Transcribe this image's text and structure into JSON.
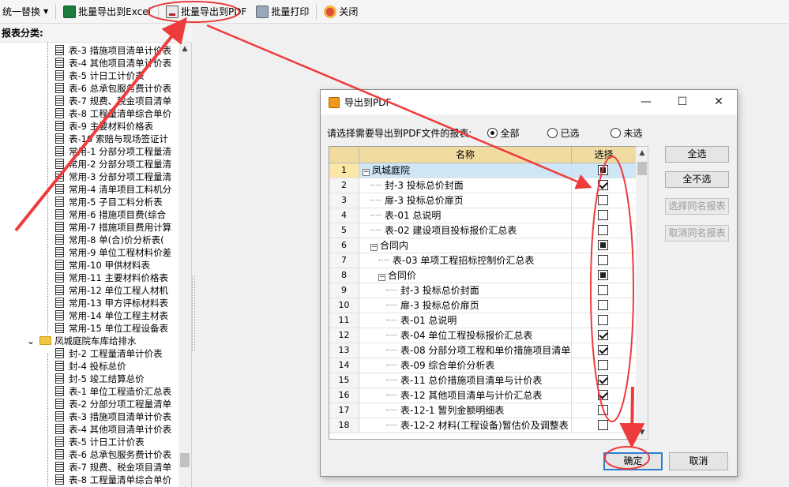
{
  "toolbar": {
    "replace_label": "统一替换",
    "export_excel_label": "批量导出到Excel",
    "export_pdf_label": "批量导出到PDF",
    "batch_print_label": "批量打印",
    "close_label": "关闭"
  },
  "left_panel": {
    "header": "报表分类:",
    "items": [
      {
        "label": "表-3 措施项目清单计价表",
        "type": "doc",
        "indent": 1
      },
      {
        "label": "表-4 其他项目清单计价表",
        "type": "doc",
        "indent": 1
      },
      {
        "label": "表-5 计日工计价表",
        "type": "doc",
        "indent": 1
      },
      {
        "label": "表-6 总承包服务费计价表",
        "type": "doc",
        "indent": 1
      },
      {
        "label": "表-7 规费、税金项目清单",
        "type": "doc",
        "indent": 1
      },
      {
        "label": "表-8 工程量清单综合单价",
        "type": "doc",
        "indent": 1
      },
      {
        "label": "表-9 主要材料价格表",
        "type": "doc",
        "indent": 1
      },
      {
        "label": "表-10 索赔与现场签证计",
        "type": "doc",
        "indent": 1
      },
      {
        "label": "常用-1 分部分项工程量清",
        "type": "doc",
        "indent": 1
      },
      {
        "label": "常用-2 分部分项工程量清",
        "type": "doc",
        "indent": 1
      },
      {
        "label": "常用-3 分部分项工程量清",
        "type": "doc",
        "indent": 1
      },
      {
        "label": "常用-4 清单项目工料机分",
        "type": "doc",
        "indent": 1
      },
      {
        "label": "常用-5 子目工料分析表",
        "type": "doc",
        "indent": 1
      },
      {
        "label": "常用-6 措施项目费(综合",
        "type": "doc",
        "indent": 1
      },
      {
        "label": "常用-7 措施项目费用计算",
        "type": "doc",
        "indent": 1
      },
      {
        "label": "常用-8 单(合)价分析表(",
        "type": "doc",
        "indent": 1
      },
      {
        "label": "常用-9 单位工程材料价差",
        "type": "doc",
        "indent": 1
      },
      {
        "label": "常用-10 甲供材料表",
        "type": "doc",
        "indent": 1
      },
      {
        "label": "常用-11 主要材料价格表",
        "type": "doc",
        "indent": 1
      },
      {
        "label": "常用-12 单位工程人材机",
        "type": "doc",
        "indent": 1
      },
      {
        "label": "常用-13 甲方评标材料表",
        "type": "doc",
        "indent": 1
      },
      {
        "label": "常用-14 单位工程主材表",
        "type": "doc",
        "indent": 1
      },
      {
        "label": "常用-15 单位工程设备表",
        "type": "doc",
        "indent": 1
      },
      {
        "label": "凤城庭院车库给排水",
        "type": "folder",
        "indent": 0
      },
      {
        "label": "封-2 工程量清单计价表",
        "type": "doc",
        "indent": 1
      },
      {
        "label": "封-4 投标总价",
        "type": "doc",
        "indent": 1
      },
      {
        "label": "封-5 竣工结算总价",
        "type": "doc",
        "indent": 1
      },
      {
        "label": "表-1 单位工程造价汇总表",
        "type": "doc",
        "indent": 1
      },
      {
        "label": "表-2 分部分项工程量清单",
        "type": "doc",
        "indent": 1
      },
      {
        "label": "表-3 措施项目清单计价表",
        "type": "doc",
        "indent": 1
      },
      {
        "label": "表-4 其他项目清单计价表",
        "type": "doc",
        "indent": 1
      },
      {
        "label": "表-5 计日工计价表",
        "type": "doc",
        "indent": 1
      },
      {
        "label": "表-6 总承包服务费计价表",
        "type": "doc",
        "indent": 1
      },
      {
        "label": "表-7 规费、税金项目清单",
        "type": "doc",
        "indent": 1
      },
      {
        "label": "表-8 工程量清单综合单价",
        "type": "doc",
        "indent": 1
      }
    ]
  },
  "dialog": {
    "title": "导出到PDF",
    "prompt": "请选择需要导出到PDF文件的报表:",
    "radio_all": "全部",
    "radio_selected": "已选",
    "radio_unselected": "未选",
    "col_name": "名称",
    "col_select": "选择",
    "btn_select_all": "全选",
    "btn_select_none": "全不选",
    "btn_select_same": "选择同名报表",
    "btn_cancel_same": "取消同名报表",
    "btn_ok": "确定",
    "btn_cancel": "取消",
    "rows": [
      {
        "num": "1",
        "name": "凤城庭院",
        "level": 0,
        "expander": "−",
        "check": "partial",
        "selected": true
      },
      {
        "num": "2",
        "name": "封-3 投标总价封面",
        "level": 1,
        "expander": "",
        "check": "checked"
      },
      {
        "num": "3",
        "name": "扉-3 投标总价扉页",
        "level": 1,
        "expander": "",
        "check": "unchecked"
      },
      {
        "num": "4",
        "name": "表-01 总说明",
        "level": 1,
        "expander": "",
        "check": "unchecked"
      },
      {
        "num": "5",
        "name": "表-02 建设项目投标报价汇总表",
        "level": 1,
        "expander": "",
        "check": "unchecked"
      },
      {
        "num": "6",
        "name": "合同内",
        "level": 1,
        "expander": "−",
        "check": "partial"
      },
      {
        "num": "7",
        "name": "表-03 单项工程招标控制价汇总表",
        "level": 2,
        "expander": "",
        "check": "unchecked"
      },
      {
        "num": "8",
        "name": "合同价",
        "level": 2,
        "expander": "−",
        "check": "partial"
      },
      {
        "num": "9",
        "name": "封-3 投标总价封面",
        "level": 3,
        "expander": "",
        "check": "unchecked"
      },
      {
        "num": "10",
        "name": "扉-3 投标总价扉页",
        "level": 3,
        "expander": "",
        "check": "unchecked"
      },
      {
        "num": "11",
        "name": "表-01 总说明",
        "level": 3,
        "expander": "",
        "check": "unchecked"
      },
      {
        "num": "12",
        "name": "表-04 单位工程投标报价汇总表",
        "level": 3,
        "expander": "",
        "check": "checked"
      },
      {
        "num": "13",
        "name": "表-08 分部分项工程和单价措施项目清单",
        "level": 3,
        "expander": "",
        "check": "checked"
      },
      {
        "num": "14",
        "name": "表-09 综合单价分析表",
        "level": 3,
        "expander": "",
        "check": "unchecked"
      },
      {
        "num": "15",
        "name": "表-11 总价措施项目清单与计价表",
        "level": 3,
        "expander": "",
        "check": "checked"
      },
      {
        "num": "16",
        "name": "表-12 其他项目清单与计价汇总表",
        "level": 3,
        "expander": "",
        "check": "checked"
      },
      {
        "num": "17",
        "name": "表-12-1 暂列金额明细表",
        "level": 3,
        "expander": "",
        "check": "unchecked"
      },
      {
        "num": "18",
        "name": "表-12-2 材料(工程设备)暂估价及调整表",
        "level": 3,
        "expander": "",
        "check": "unchecked"
      }
    ]
  },
  "colors": {
    "annotation_red": "#ee3b3b",
    "grid_header": "#f0dca0",
    "row_selected": "#cfe6f7",
    "primary_border": "#2c7fd1"
  }
}
